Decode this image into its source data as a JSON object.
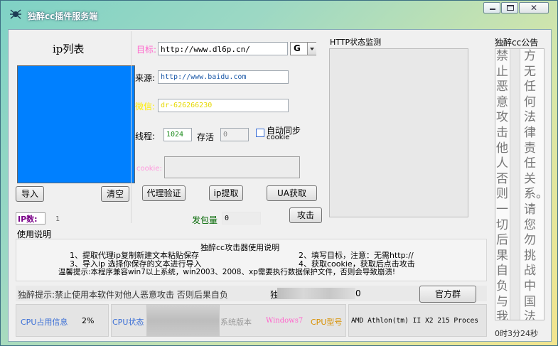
{
  "window": {
    "title": "独醉cc插件服务端",
    "minimize_label": "",
    "maximize_label": "",
    "close_label": ""
  },
  "left": {
    "ip_list_title": "ip列表",
    "import_button": "导入",
    "clear_button": "清空",
    "ip_count_label": "IP数:",
    "ip_count_value": "1"
  },
  "form": {
    "target_label": "目标:",
    "target_value": "http://www.dl6p.cn/",
    "target_method": "G",
    "source_label": "来源:",
    "source_value": "http://www.baidu.com",
    "ua_label": "微信:",
    "ua_value": "dr-626266230",
    "threads_label": "线程:",
    "threads_value": "1024",
    "keepalive_label": "存活",
    "keepalive_value": "0",
    "auto_sync_label": "自动同步",
    "auto_sync_sub": "cookie",
    "cookie_label": "cookie:",
    "proxy_verify_button": "代理验证",
    "ip_extract_button": "ip提取",
    "ua_fetch_button": "UA获取",
    "send_count_label": "发包量",
    "send_count_value": "0",
    "attack_button": "攻击"
  },
  "http_monitor": {
    "title": "HTTP状态监测"
  },
  "notice": {
    "title": "独醉cc公告",
    "col_right": "方无任何法律责任关系。请您勿挑战中国法律",
    "col_left": "禁止恶意攻击他人，否则一切后果自负，与我"
  },
  "instructions": {
    "group_label": "使用说明",
    "heading": "独醉cc攻击器使用说明",
    "line1a": "1、提取代理ip复制新建文本粘贴保存",
    "line1b": "2、填写目标，注意：无需http://",
    "line2a": "3、导入ip 选择你保存的文本进行导入",
    "line2b": "4、获取cookie，获取后点击攻击",
    "tip": "温馨提示:本程序兼容win7以上系统，win2003、2008、xp需要执行数据保护文件，否则会导致崩溃!"
  },
  "footer": {
    "warning": "独醉提示:禁止使用本软件对他人恶意攻击 否则后果自负",
    "partial_label": "独",
    "counter_value": "0",
    "official_group_button": "官方群",
    "cpu_usage_label": "CPU占用信息",
    "cpu_usage_value": "2%",
    "cpu_state_label": "CPU状态",
    "sys_version_label": "系统版本",
    "sys_version_value": "Windows7",
    "cpu_model_label": "CPU型号",
    "cpu_model_value": "AMD Athlon(tm) II X2 215 Proces",
    "runtime": "0时3分24秒"
  },
  "colors": {
    "ip_list_bg": "#0080ff",
    "accent_red": "#cc0000",
    "cpu_blue": "#3b6fd6",
    "pink": "#ff66cc",
    "orange": "#d89000"
  }
}
